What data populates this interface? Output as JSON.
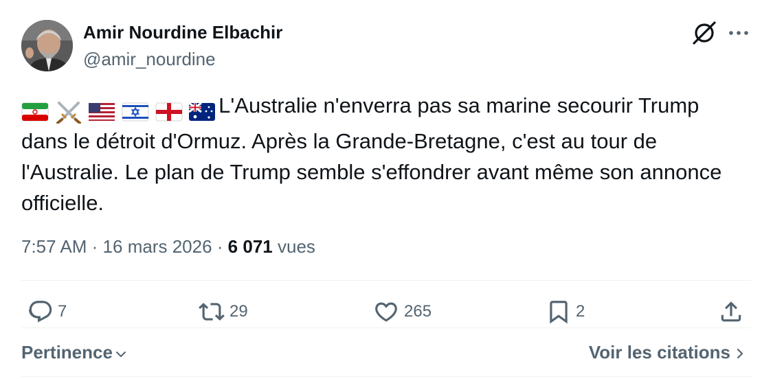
{
  "author": {
    "display_name": "Amir Nourdine Elbachir",
    "handle": "@amir_nourdine"
  },
  "tweet": {
    "text": "L'Australie n'enverra pas sa marine secourir Trump dans le détroit d'Ormuz. Après la Grande-Bretagne, c'est au tour de l'Australie. Le plan de Trump semble s'effondrer avant même son annonce officielle.",
    "emoji_prefix": [
      "iran-flag",
      "crossed-swords",
      "usa-flag",
      "israel-flag",
      "england-flag",
      "australia-flag"
    ]
  },
  "meta": {
    "time": "7:57 AM",
    "separator": "·",
    "date": "16 mars 2026",
    "views_count": "6 071",
    "views_label": "vues"
  },
  "actions": {
    "replies": "7",
    "reposts": "29",
    "likes": "265",
    "bookmarks": "2"
  },
  "footer": {
    "sort_label": "Pertinence",
    "quotes_label": "Voir les citations"
  },
  "colors": {
    "text": "#0f1419",
    "secondary": "#536471",
    "divider": "#eff3f4"
  }
}
